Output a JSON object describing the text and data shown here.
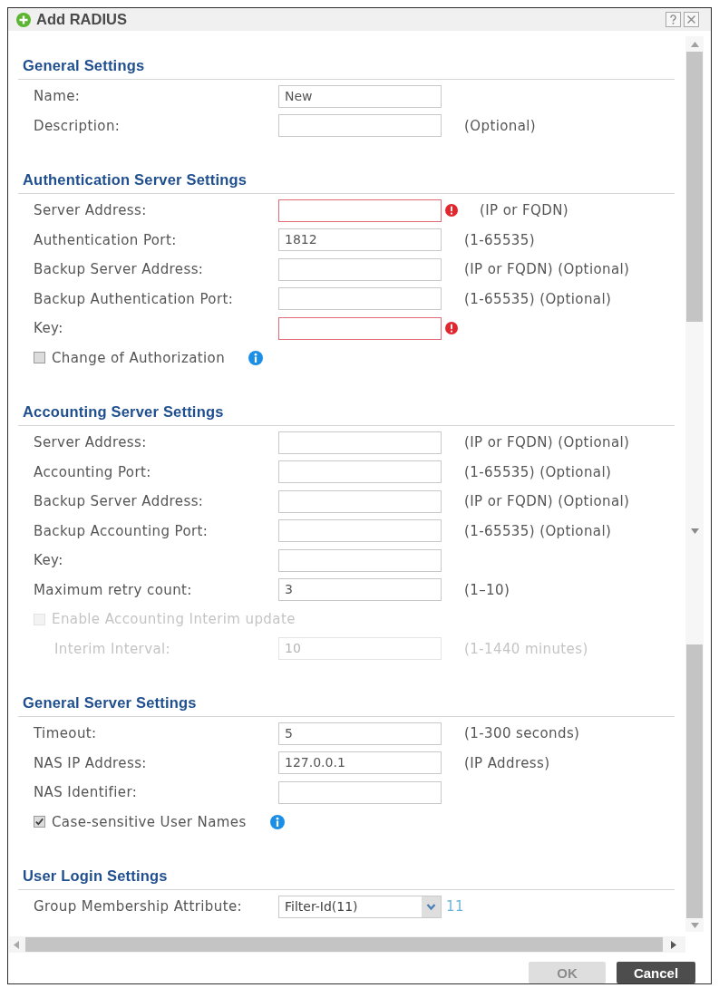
{
  "window": {
    "title": "Add RADIUS"
  },
  "sections": [
    {
      "title": "General Settings",
      "rows": [
        {
          "kind": "field",
          "label": "Name:",
          "value": "New",
          "error": false,
          "disabled": false
        },
        {
          "kind": "field",
          "label": "Description:",
          "hint": "(Optional)",
          "error": false,
          "disabled": false
        }
      ]
    },
    {
      "title": "Authentication Server Settings",
      "rows": [
        {
          "kind": "field",
          "label": "Server Address:",
          "hint": "(IP or FQDN)",
          "error": true,
          "disabled": false
        },
        {
          "kind": "field",
          "label": "Authentication Port:",
          "value": "1812",
          "hint": "(1-65535)",
          "error": false,
          "disabled": false
        },
        {
          "kind": "field",
          "label": "Backup Server Address:",
          "hint": "(IP or FQDN) (Optional)",
          "error": false,
          "disabled": false
        },
        {
          "kind": "field",
          "label": "Backup Authentication Port:",
          "hint": "(1-65535) (Optional)",
          "error": false,
          "disabled": false
        },
        {
          "kind": "field",
          "label": "Key:",
          "error": true,
          "disabled": false
        },
        {
          "kind": "checkbox",
          "label": "Change of Authorization",
          "checked": false,
          "disabled": false,
          "info": true
        }
      ]
    },
    {
      "title": "Accounting Server Settings",
      "rows": [
        {
          "kind": "field",
          "label": "Server Address:",
          "hint": "(IP or FQDN) (Optional)",
          "error": false,
          "disabled": false
        },
        {
          "kind": "field",
          "label": "Accounting Port:",
          "hint": "(1-65535) (Optional)",
          "error": false,
          "disabled": false
        },
        {
          "kind": "field",
          "label": "Backup Server Address:",
          "hint": "(IP or FQDN) (Optional)",
          "error": false,
          "disabled": false
        },
        {
          "kind": "field",
          "label": "Backup Accounting Port:",
          "hint": "(1-65535) (Optional)",
          "error": false,
          "disabled": false
        },
        {
          "kind": "field",
          "label": "Key:",
          "error": false,
          "disabled": false
        },
        {
          "kind": "field",
          "label": "Maximum retry count:",
          "value": "3",
          "hint": "(1–10)",
          "error": false,
          "disabled": false
        },
        {
          "kind": "checkbox",
          "label": "Enable Accounting Interim update",
          "checked": false,
          "disabled": true,
          "children": [
            {
              "kind": "field",
              "label": "Interim Interval:",
              "value": "10",
              "hint": "(1-1440 minutes)",
              "error": false,
              "disabled": true
            }
          ]
        }
      ]
    },
    {
      "title": "General Server Settings",
      "rows": [
        {
          "kind": "field",
          "label": "Timeout:",
          "value": "5",
          "hint": "(1-300 seconds)",
          "error": false,
          "disabled": false
        },
        {
          "kind": "field",
          "label": "NAS IP Address:",
          "value": "127.0.0.1",
          "hint": "(IP Address)",
          "error": false,
          "disabled": false
        },
        {
          "kind": "field",
          "label": "NAS Identifier:",
          "error": false,
          "disabled": false
        },
        {
          "kind": "checkbox",
          "label": "Case-sensitive User Names",
          "checked": true,
          "disabled": false,
          "info": true
        }
      ]
    },
    {
      "title": "User Login Settings",
      "rows": [
        {
          "kind": "select",
          "label": "Group Membership Attribute:",
          "value": "Filter-Id(11)",
          "suffix": "11",
          "disabled": false
        }
      ]
    }
  ],
  "buttons": [
    {
      "label": "OK",
      "disabled": true
    },
    {
      "label": "Cancel",
      "disabled": false
    }
  ]
}
